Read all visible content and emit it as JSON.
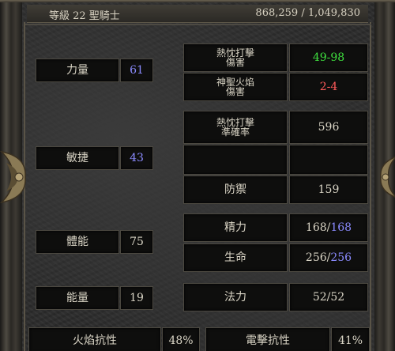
{
  "header": {
    "left": "等級 22 聖騎士",
    "right": "868,259 / 1,049,830"
  },
  "attributes": {
    "strength": {
      "label": "力量",
      "value": "61"
    },
    "dexterity": {
      "label": "敏捷",
      "value": "43"
    },
    "vitality": {
      "label": "體能",
      "value": "75"
    },
    "energy": {
      "label": "能量",
      "value": "19"
    }
  },
  "combat": {
    "zeal_damage": {
      "label_line1": "熱忱打擊",
      "label_line2": "傷害",
      "value": "49-98"
    },
    "holy_fire_damage": {
      "label_line1": "神聖火焰",
      "label_line2": "傷害",
      "value": "2-4"
    },
    "zeal_rating": {
      "label_line1": "熱忱打擊",
      "label_line2": "準確率",
      "value": "596"
    },
    "defense": {
      "label": "防禦",
      "value": "159"
    }
  },
  "pools": {
    "stamina": {
      "label": "精力",
      "current": "168",
      "max": "168"
    },
    "life": {
      "label": "生命",
      "current": "256",
      "max": "256"
    },
    "mana": {
      "label": "法力",
      "current": "52",
      "max": "52"
    }
  },
  "resistances": {
    "fire": {
      "label": "火焰抗性",
      "value": "48%"
    },
    "lightning": {
      "label": "電擊抗性",
      "value": "41%"
    }
  },
  "colors": {
    "stat_blue": "#8b8bff",
    "damage_green": "#3fe03f",
    "damage_red": "#ff5a5a"
  }
}
